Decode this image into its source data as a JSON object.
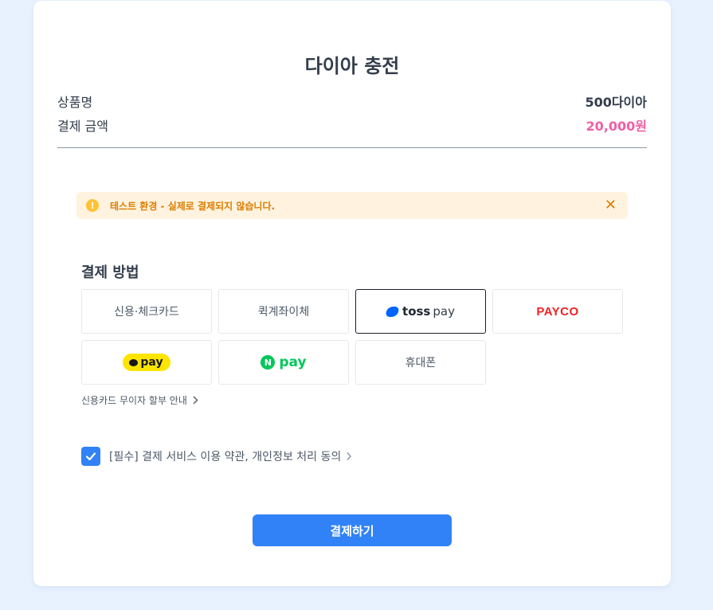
{
  "header": {
    "title": "다이아 충전"
  },
  "summary": {
    "product_label": "상품명",
    "product_value": "500다이아",
    "amount_label": "결제 금액",
    "amount_value": "20,000원"
  },
  "alert": {
    "icon": "exclamation-icon",
    "icon_glyph": "!",
    "text": "테스트 환경 - 실제로 결제되지 않습니다.",
    "close_glyph": "✕"
  },
  "payment": {
    "section_title": "결제 방법",
    "methods": [
      {
        "label": "신용·체크카드"
      },
      {
        "label": "퀵계좌이체"
      },
      {
        "brand": "toss",
        "word1": "toss",
        "word2": "pay",
        "selected": true
      },
      {
        "brand": "payco",
        "label": "PAYCO"
      },
      {
        "brand": "kakaopay",
        "label": "pay"
      },
      {
        "brand": "naverpay",
        "mark": "N",
        "label": "pay"
      },
      {
        "label": "휴대폰"
      }
    ],
    "installment_link": "신용카드 무이자 할부 안내"
  },
  "agreement": {
    "checked": true,
    "text": "[필수] 결제 서비스 이용 약관, 개인정보 처리 동의"
  },
  "submit": {
    "label": "결제하기"
  },
  "colors": {
    "primary": "#3182f6",
    "price": "#f35ea4",
    "alert_bg": "#fff3df",
    "alert_text": "#dd7d02",
    "payco_red": "#f41f24",
    "kakao_yellow": "#fee500",
    "naver_green": "#03c75a",
    "toss_blue": "#0064ff"
  }
}
